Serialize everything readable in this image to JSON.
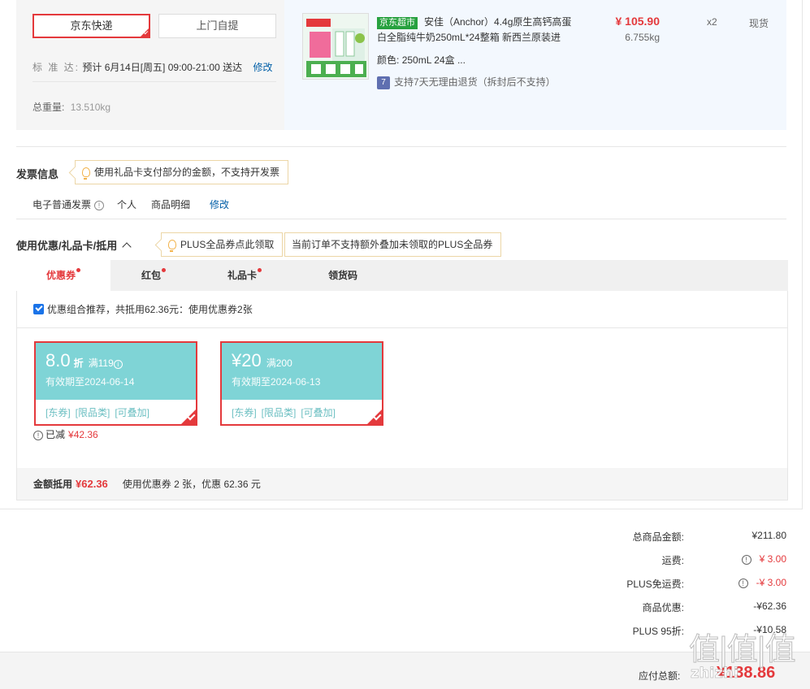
{
  "shipping": {
    "methods": [
      {
        "label": "京东快递",
        "selected": true
      },
      {
        "label": "上门自提",
        "selected": false
      }
    ],
    "time_label": "标 准 达:",
    "time_value": "预计 6月14日[周五] 09:00-21:00 送达",
    "modify": "修改",
    "weight_label": "总重量:",
    "weight_value": "13.510kg"
  },
  "goods": {
    "market_tag": "京东超市",
    "title": "安佳（Anchor）4.4g原生高钙高蛋白全脂纯牛奶250mL*24整箱 新西兰原装进",
    "attr_label": "颜色:",
    "attr_value": "250mL 24盒 ...",
    "return_icon": "7",
    "return_text": "支持7天无理由退货（拆封后不支持）",
    "price": "¥ 105.90",
    "weight": "6.755kg",
    "qty": "x2",
    "stock": "现货"
  },
  "invoice": {
    "title": "发票信息",
    "tip": "使用礼品卡支付部分的金额，不支持开发票",
    "type": "电子普通发票",
    "info_icon": "!",
    "person": "个人",
    "detail": "商品明细",
    "modify": "修改"
  },
  "discount": {
    "title": "使用优惠/礼品卡/抵用",
    "plus_tip": "PLUS全品券点此领取",
    "plus_notice": "当前订单不支持额外叠加未领取的PLUS全品券",
    "tabs": [
      {
        "label": "优惠券",
        "dot": true,
        "active": true
      },
      {
        "label": "红包",
        "dot": true,
        "active": false
      },
      {
        "label": "礼品卡",
        "dot": true,
        "active": false
      },
      {
        "label": "领货码",
        "dot": false,
        "active": false
      }
    ],
    "combo_text": "优惠组合推荐，共抵用62.36元：使用优惠券2张",
    "coupons": [
      {
        "amount": "8.0",
        "unit": "折",
        "cond": "满119",
        "info_icon": "i",
        "expiry": "有效期至2024-06-14",
        "tags": [
          "[东券]",
          "[限品类]",
          "[可叠加]"
        ]
      },
      {
        "amount": "¥20",
        "unit": "",
        "cond": "满200",
        "info_icon": "",
        "expiry": "有效期至2024-06-13",
        "tags": [
          "[东券]",
          "[限品类]",
          "[可叠加]"
        ]
      }
    ],
    "reduced_label": "已减",
    "reduced_value": "¥42.36",
    "sum_label": "金额抵用",
    "sum_value": "¥62.36",
    "sum_desc": "使用优惠券 2 张，优惠 62.36 元"
  },
  "totals": {
    "rows": [
      {
        "label": "总商品金额:",
        "value": "¥211.80",
        "accent": false,
        "info": false
      },
      {
        "label": "运费:",
        "value": "¥ 3.00",
        "accent": true,
        "info": true
      },
      {
        "label": "PLUS免运费:",
        "value": "-¥ 3.00",
        "accent": true,
        "info": true
      },
      {
        "label": "商品优惠:",
        "value": "-¥62.36",
        "accent": false,
        "info": false
      },
      {
        "label": "PLUS 95折:",
        "value": "-¥10.58",
        "accent": false,
        "info": false
      }
    ],
    "pay_label": "应付总额:",
    "pay_value": "¥138.86"
  },
  "watermark": {
    "glyphs": "值|值|值",
    "site": "zhizhi"
  },
  "colors": {
    "accent": "#e4393c",
    "coupon": "#7fd4d6",
    "link": "#005ea7",
    "market": "#27a13f"
  }
}
